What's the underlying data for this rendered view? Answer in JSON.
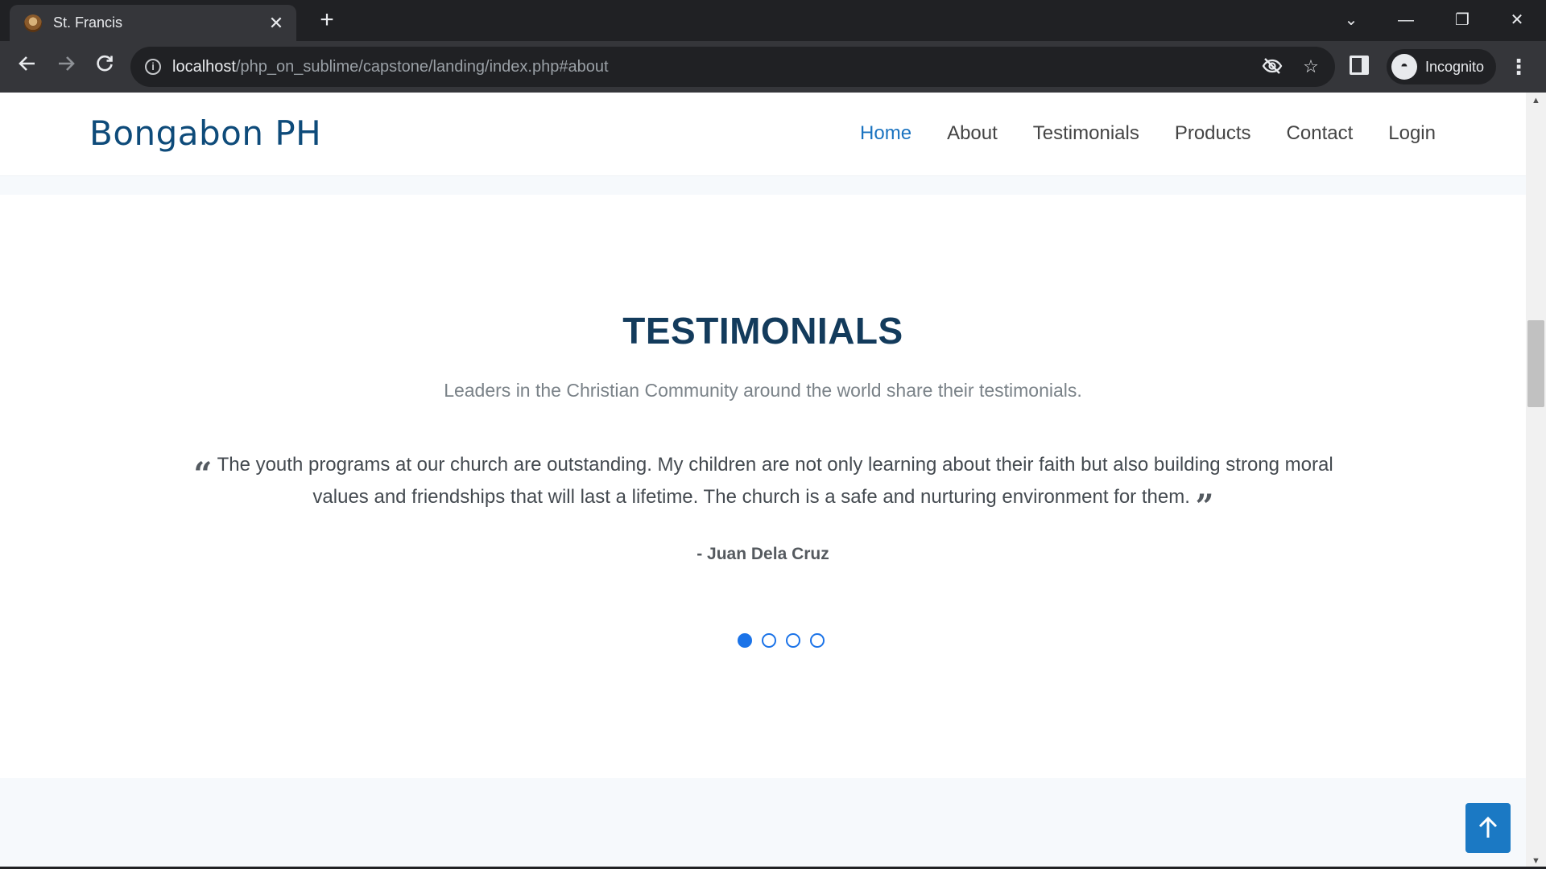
{
  "browser": {
    "tab_title": "St. Francis",
    "tab_close": "✕",
    "new_tab": "+",
    "url_host": "localhost",
    "url_path": "/php_on_sublime/capstone/landing/index.php#about",
    "profile_label": "Incognito",
    "icons": {
      "back": "arrow-left-icon",
      "forward": "arrow-right-icon",
      "reload": "reload-icon",
      "info": "info-icon",
      "eye_off": "eye-off-icon",
      "star": "star-icon",
      "side_panel": "side-panel-icon",
      "menu": "kebab-menu-icon"
    }
  },
  "site": {
    "brand": "Bongabon PH",
    "nav": [
      {
        "label": "Home",
        "active": true
      },
      {
        "label": "About",
        "active": false
      },
      {
        "label": "Testimonials",
        "active": false
      },
      {
        "label": "Products",
        "active": false
      },
      {
        "label": "Contact",
        "active": false
      },
      {
        "label": "Login",
        "active": false
      }
    ]
  },
  "testimonials": {
    "title": "TESTIMONIALS",
    "subtitle": "Leaders in the Christian Community around the world share their testimonials.",
    "quote": "The youth programs at our church are outstanding. My children are not only learning about their faith but also building strong moral values and friendships that will last a lifetime. The church is a safe and nurturing environment for them.",
    "author": "- Juan Dela Cruz",
    "slide_count": 4,
    "active_slide": 1
  },
  "colors": {
    "accent": "#1b73e8",
    "brand": "#0e4b7a",
    "title": "#133b5c",
    "back_to_top": "#1b79c4"
  }
}
